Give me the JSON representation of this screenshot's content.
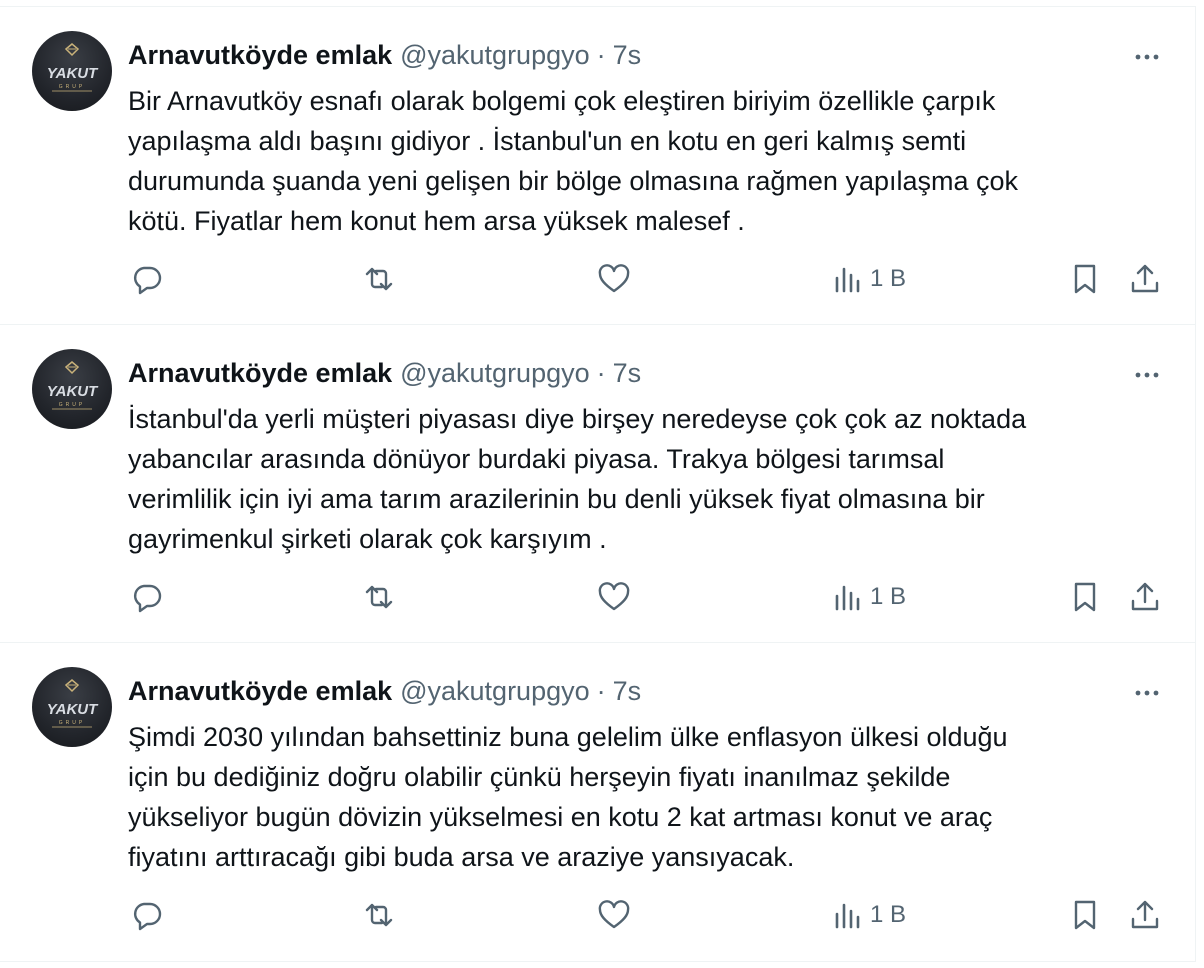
{
  "tweets": [
    {
      "author_name": "Arnavutköyde emlak",
      "handle": "@yakutgrupgyo",
      "separator": "·",
      "time": "7s",
      "text": "Bir Arnavutköy esnafı olarak bolgemi çok eleştiren biriyim özellikle çarpık\nyapılaşma aldı başını gidiyor . İstanbul'un en kotu en geri kalmış semti\ndurumunda şuanda yeni gelişen bir bölge olmasına rağmen yapılaşma çok\nkötü. Fiyatlar hem konut hem arsa yüksek malesef .",
      "views": "1 B"
    },
    {
      "author_name": "Arnavutköyde emlak",
      "handle": "@yakutgrupgyo",
      "separator": "·",
      "time": "7s",
      "text": "İstanbul'da yerli müşteri piyasası diye birşey neredeyse çok çok az noktada\nyabancılar arasında dönüyor burdaki piyasa. Trakya bölgesi tarımsal\nverimlilik için iyi ama tarım arazilerinin bu denli yüksek fiyat olmasına bir\ngayrimenkul şirketi olarak çok karşıyım .",
      "views": "1 B"
    },
    {
      "author_name": "Arnavutköyde emlak",
      "handle": "@yakutgrupgyo",
      "separator": "·",
      "time": "7s",
      "text": "Şimdi 2030 yılından bahsettiniz buna gelelim ülke enflasyon ülkesi olduğu\niçin bu dediğiniz doğru olabilir çünkü herşeyin fiyatı inanılmaz şekilde\nyükseliyor bugün dövizin yükselmesi en kotu 2 kat artması konut ve araç\nfiyatını arttıracağı gibi buda arsa ve araziye yansıyacak.",
      "views": "1 B"
    }
  ],
  "avatar": {
    "logo_text": "YAKUT",
    "sub_text": "GRUP"
  },
  "icons": {
    "reply": "reply-icon",
    "retweet": "retweet-icon",
    "like": "like-icon",
    "views": "views-icon",
    "bookmark": "bookmark-icon",
    "share": "share-icon",
    "more": "more-icon"
  },
  "colors": {
    "text": "#0f1419",
    "secondary": "#536471",
    "border": "#eff3f4"
  }
}
